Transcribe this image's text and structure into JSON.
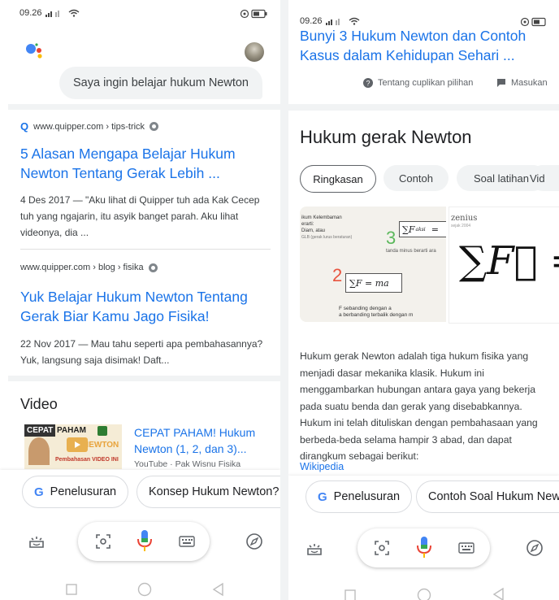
{
  "left": {
    "status_time": "09.26",
    "query": "Saya ingin belajar hukum Newton",
    "result1": {
      "url": "www.quipper.com › tips-trick",
      "title": "5 Alasan Mengapa Belajar Hukum Newton Tentang Gerak Lebih ...",
      "snippet": "4 Des 2017 — \"Aku lihat di Quipper tuh ada Kak Cecep tuh yang ngajarin, itu asyik banget parah. Aku lihat videonya, dia  ..."
    },
    "result2": {
      "url": "www.quipper.com › blog › fisika",
      "title": "Yuk Belajar Hukum Newton Tentang Gerak Biar Kamu Jago Fisika!",
      "snippet": "22 Nov 2017 — Mau tahu seperti apa pembahasannya? Yuk, langsung saja disimak! Daft..."
    },
    "video_heading": "Video",
    "video": {
      "thumb_label1": "CEPAT",
      "thumb_label2": "PAHAM",
      "thumb_label3": "NEWTON",
      "thumb_label4": "Pembahasan VIDEO INI",
      "title": "CEPAT PAHAM! Hukum Newton (1, 2, dan 3)...",
      "source": "YouTube · Pak Wisnu Fisika"
    },
    "chips": [
      "Penelusuran",
      "Konsep Hukum Newton?"
    ]
  },
  "right": {
    "status_time": "09.26",
    "top_title": "Bunyi 3 Hukum Newton dan Contoh Kasus dalam Kehidupan Sehari ...",
    "about_label": "Tentang cuplikan pilihan",
    "feedback_label": "Masukan",
    "panel_title": "Hukum gerak Newton",
    "tabs": [
      "Ringkasan",
      "Contoh",
      "Soal latihan",
      "Vid"
    ],
    "image1": {
      "line1": "ikum Kelembaman",
      "line2": "erarti:",
      "line3": "Diam, atau",
      "line4": "GLB (gerak lurus beraturan)",
      "num3": "3",
      "sum3": "∑F",
      "sub3": "aksi",
      "eq3": "=",
      "minus_note": "tanda minus berarti ara",
      "num2": "2",
      "formula2": "∑F = ma",
      "note_a": "F sebanding dengan a",
      "note_b": "a berbanding terbalik dengan m"
    },
    "image2": {
      "brand": "zenius",
      "brand_sub": "sejak 2004",
      "formula": "∑F⃗ = r"
    },
    "description": "Hukum gerak Newton adalah tiga hukum fisika yang menjadi dasar mekanika klasik. Hukum ini menggambarkan hubungan antara gaya yang bekerja pada suatu benda dan gerak yang disebabkannya. Hukum ini telah dituliskan dengan pembahasaan yang berbeda-beda selama hampir 3 abad, dan dapat dirangkum sebagai berikut:",
    "source": "Wikipedia",
    "chips": [
      "Penelusuran",
      "Contoh Soal Hukum New"
    ]
  }
}
